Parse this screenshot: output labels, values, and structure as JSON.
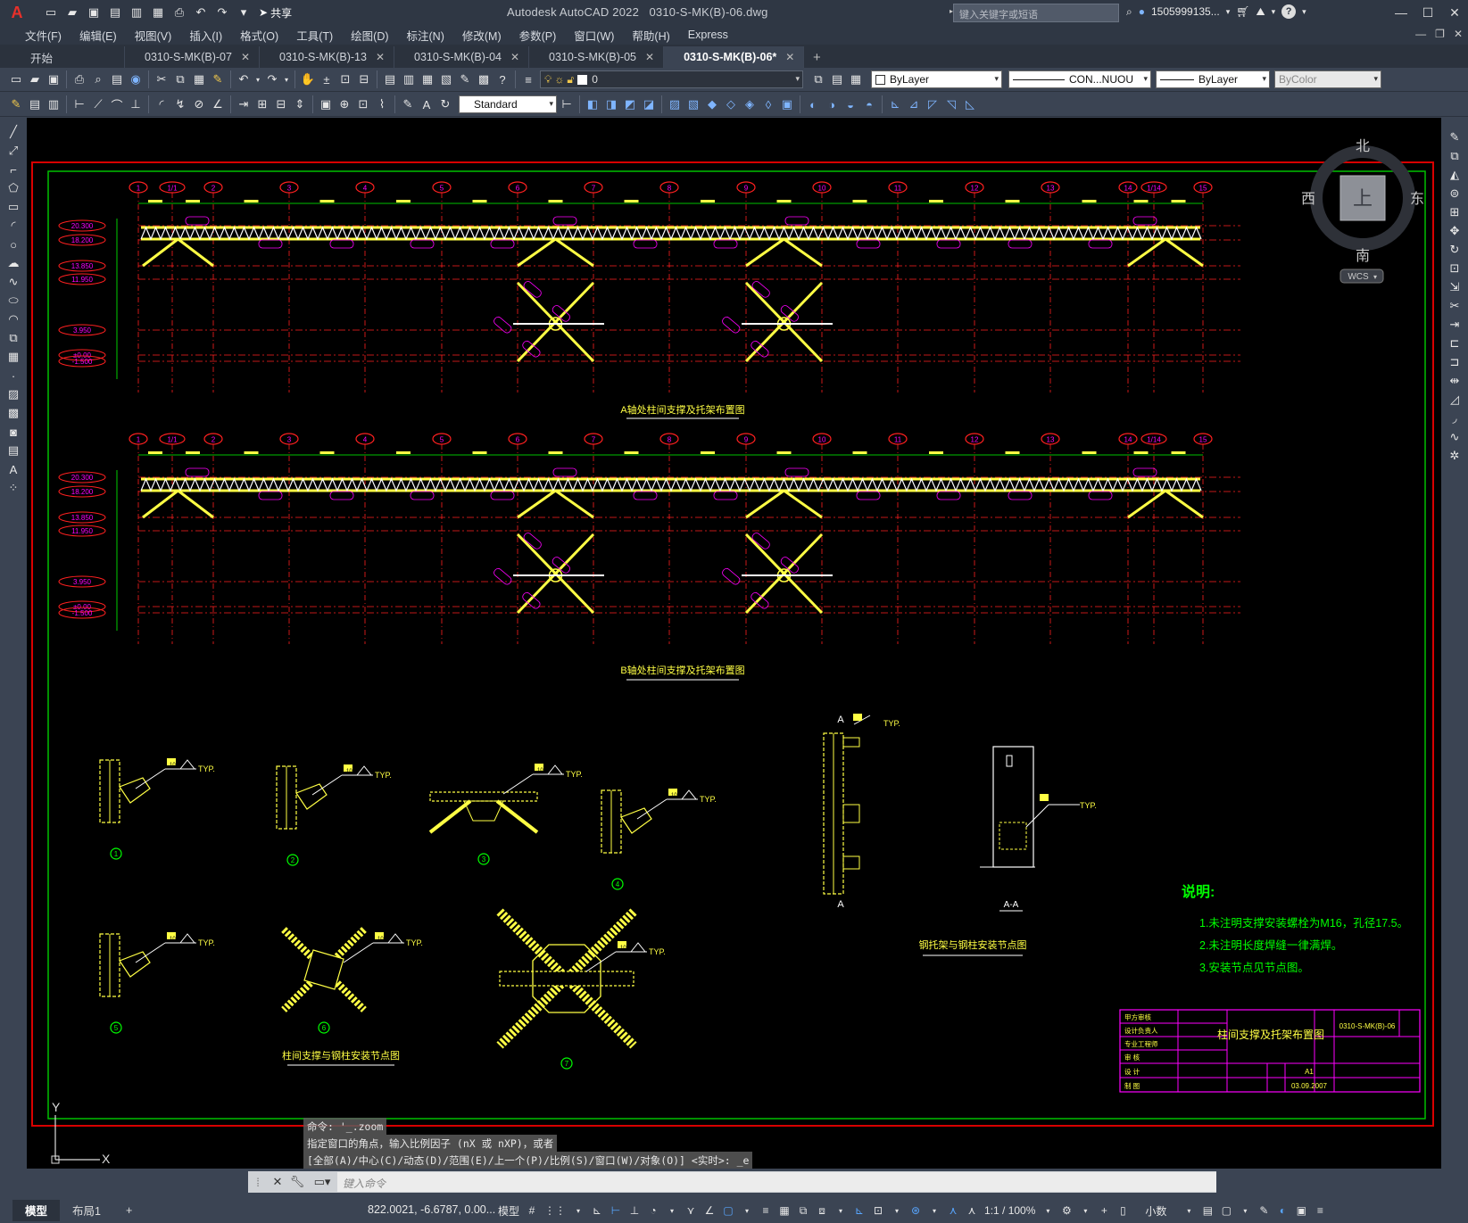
{
  "title_bar": {
    "app_title": "Autodesk AutoCAD 2022",
    "file_name": "0310-S-MK(B)-06.dwg",
    "share_label": "共享",
    "search_placeholder": "键入关键字或短语",
    "user": "1505999135...",
    "window_controls": [
      "minimize",
      "maximize",
      "close"
    ]
  },
  "menu": {
    "items": [
      "文件(F)",
      "编辑(E)",
      "视图(V)",
      "插入(I)",
      "格式(O)",
      "工具(T)",
      "绘图(D)",
      "标注(N)",
      "修改(M)",
      "参数(P)",
      "窗口(W)",
      "帮助(H)",
      "Express"
    ]
  },
  "tabs": [
    {
      "label": "开始",
      "closable": false,
      "active": false
    },
    {
      "label": "0310-S-MK(B)-07",
      "closable": true,
      "active": false
    },
    {
      "label": "0310-S-MK(B)-13",
      "closable": true,
      "active": false
    },
    {
      "label": "0310-S-MK(B)-04",
      "closable": true,
      "active": false
    },
    {
      "label": "0310-S-MK(B)-05",
      "closable": true,
      "active": false
    },
    {
      "label": "0310-S-MK(B)-06*",
      "closable": true,
      "active": true
    }
  ],
  "properties": {
    "layer": "0",
    "color": "ByLayer",
    "linetype": "CON...NUOU",
    "lineweight": "ByLayer",
    "plotstyle": "ByColor",
    "text_style": "Standard"
  },
  "viewcube": {
    "north": "北",
    "south": "南",
    "east": "东",
    "west": "西",
    "face": "上",
    "wcs": "WCS"
  },
  "drawing": {
    "elev_a": [
      "20.300",
      "18.200",
      "13.850",
      "11.950",
      "3.950",
      "±0.00",
      "-1.500"
    ],
    "elev_b": [
      "20.300",
      "18.200",
      "13.850",
      "11.950",
      "3.950",
      "±0.00",
      "-1.500"
    ],
    "axes": [
      "1",
      "1/1",
      "2",
      "3",
      "4",
      "5",
      "6",
      "7",
      "8",
      "9",
      "10",
      "11",
      "12",
      "13",
      "14",
      "1/14",
      "15"
    ],
    "title_a": "A轴处柱间支撑及托架布置图",
    "title_b": "B轴处柱间支撑及托架布置图",
    "details_title_1": "柱间支撑与钢柱安装节点图",
    "details_title_2": "钢托架与钢柱安装节点图",
    "section_label": "A-A",
    "section_mark": "A",
    "typ": "TYP.",
    "weld": "10",
    "notes_title": "说明:",
    "notes": [
      "1.未注明支撑安装螺栓为M16，孔径17.5。",
      "2.未注明长度焊缝一律满焊。",
      "3.安装节点见节点图。"
    ],
    "detail_numbers": [
      "1",
      "2",
      "3",
      "4",
      "5",
      "6",
      "7"
    ],
    "title_block": {
      "drawing_name": "柱间支撑及托架布置图",
      "drawing_no": "0310-S-MK(B)-06",
      "date": "03.09.2007",
      "scale": "A1",
      "rows": [
        "甲方审核",
        "设计负责人",
        "专业工程师",
        "审 核",
        "设 计",
        "制 图"
      ]
    }
  },
  "command": {
    "history": [
      "命令: '_.zoom",
      "指定窗口的角点，输入比例因子 (nX 或 nXP)，或者",
      "[全部(A)/中心(C)/动态(D)/范围(E)/上一个(P)/比例(S)/窗口(W)/对象(O)] <实时>: _e"
    ],
    "placeholder": "键入命令"
  },
  "status": {
    "layout_tabs": [
      "模型",
      "布局1"
    ],
    "coordinates": "822.0021, -6.6787, 0.00...",
    "space": "模型",
    "scale": "1:1 / 100%",
    "units": "小数"
  },
  "ucs": {
    "x": "X",
    "y": "Y"
  },
  "colors": {
    "accent": "#58a6ff",
    "frame_red": "#d80000",
    "border_green": "#00c000",
    "member_yellow": "#ffff44",
    "label_magenta": "#ff00ff"
  }
}
